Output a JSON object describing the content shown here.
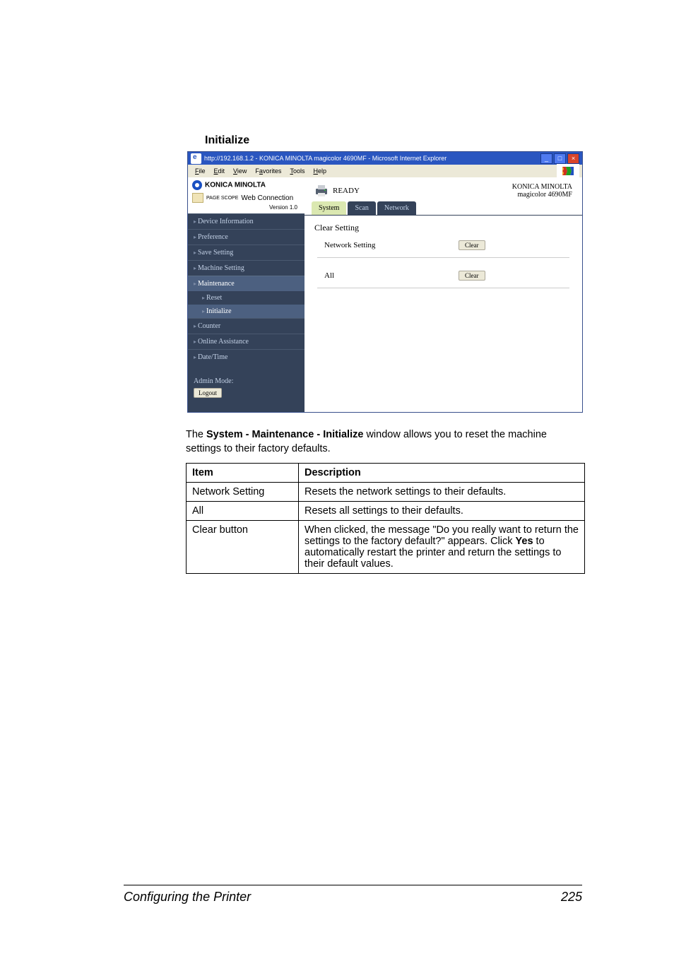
{
  "heading": "Initialize",
  "shot": {
    "title": "http://192.168.1.2 - KONICA MINOLTA magicolor 4690MF - Microsoft Internet Explorer",
    "menus": [
      "File",
      "Edit",
      "View",
      "Favorites",
      "Tools",
      "Help"
    ],
    "brand_top": "KONICA MINOLTA",
    "pagescope": "Web Connection",
    "pagescope_prefix": "PAGE SCOPE",
    "version": "Version 1.0",
    "nav": {
      "device_info": "Device Information",
      "preference": "Preference",
      "save_setting": "Save Setting",
      "machine_setting": "Machine Setting",
      "maintenance": "Maintenance",
      "reset": "Reset",
      "initialize": "Initialize",
      "counter": "Counter",
      "online_assist": "Online Assistance",
      "date_time": "Date/Time"
    },
    "admin_label": "Admin Mode:",
    "logout": "Logout",
    "ready": "READY",
    "device": {
      "line1": "KONICA MINOLTA",
      "line2": "magicolor 4690MF"
    },
    "tabs": {
      "system": "System",
      "scan": "Scan",
      "network": "Network"
    },
    "clear_setting": "Clear Setting",
    "rows": {
      "network_setting": "Network Setting",
      "all": "All"
    },
    "clear_btn": "Clear"
  },
  "body_text_1": "The ",
  "body_text_bold": "System - Maintenance - Initialize",
  "body_text_2": " window allows you to reset the machine settings to their factory defaults.",
  "table": {
    "head": {
      "item": "Item",
      "desc": "Description"
    },
    "rows": [
      {
        "item": "Network Setting",
        "desc": "Resets the network settings to their defaults."
      },
      {
        "item": "All",
        "desc": "Resets all settings to their defaults."
      },
      {
        "item": "Clear button",
        "desc_1": "When clicked, the message \"Do you really want to return the settings to the factory default?\" appears. Click ",
        "desc_bold": "Yes",
        "desc_2": " to automatically restart the printer and return the settings to their default values."
      }
    ]
  },
  "footer": {
    "title": "Configuring the Printer",
    "page": "225"
  }
}
